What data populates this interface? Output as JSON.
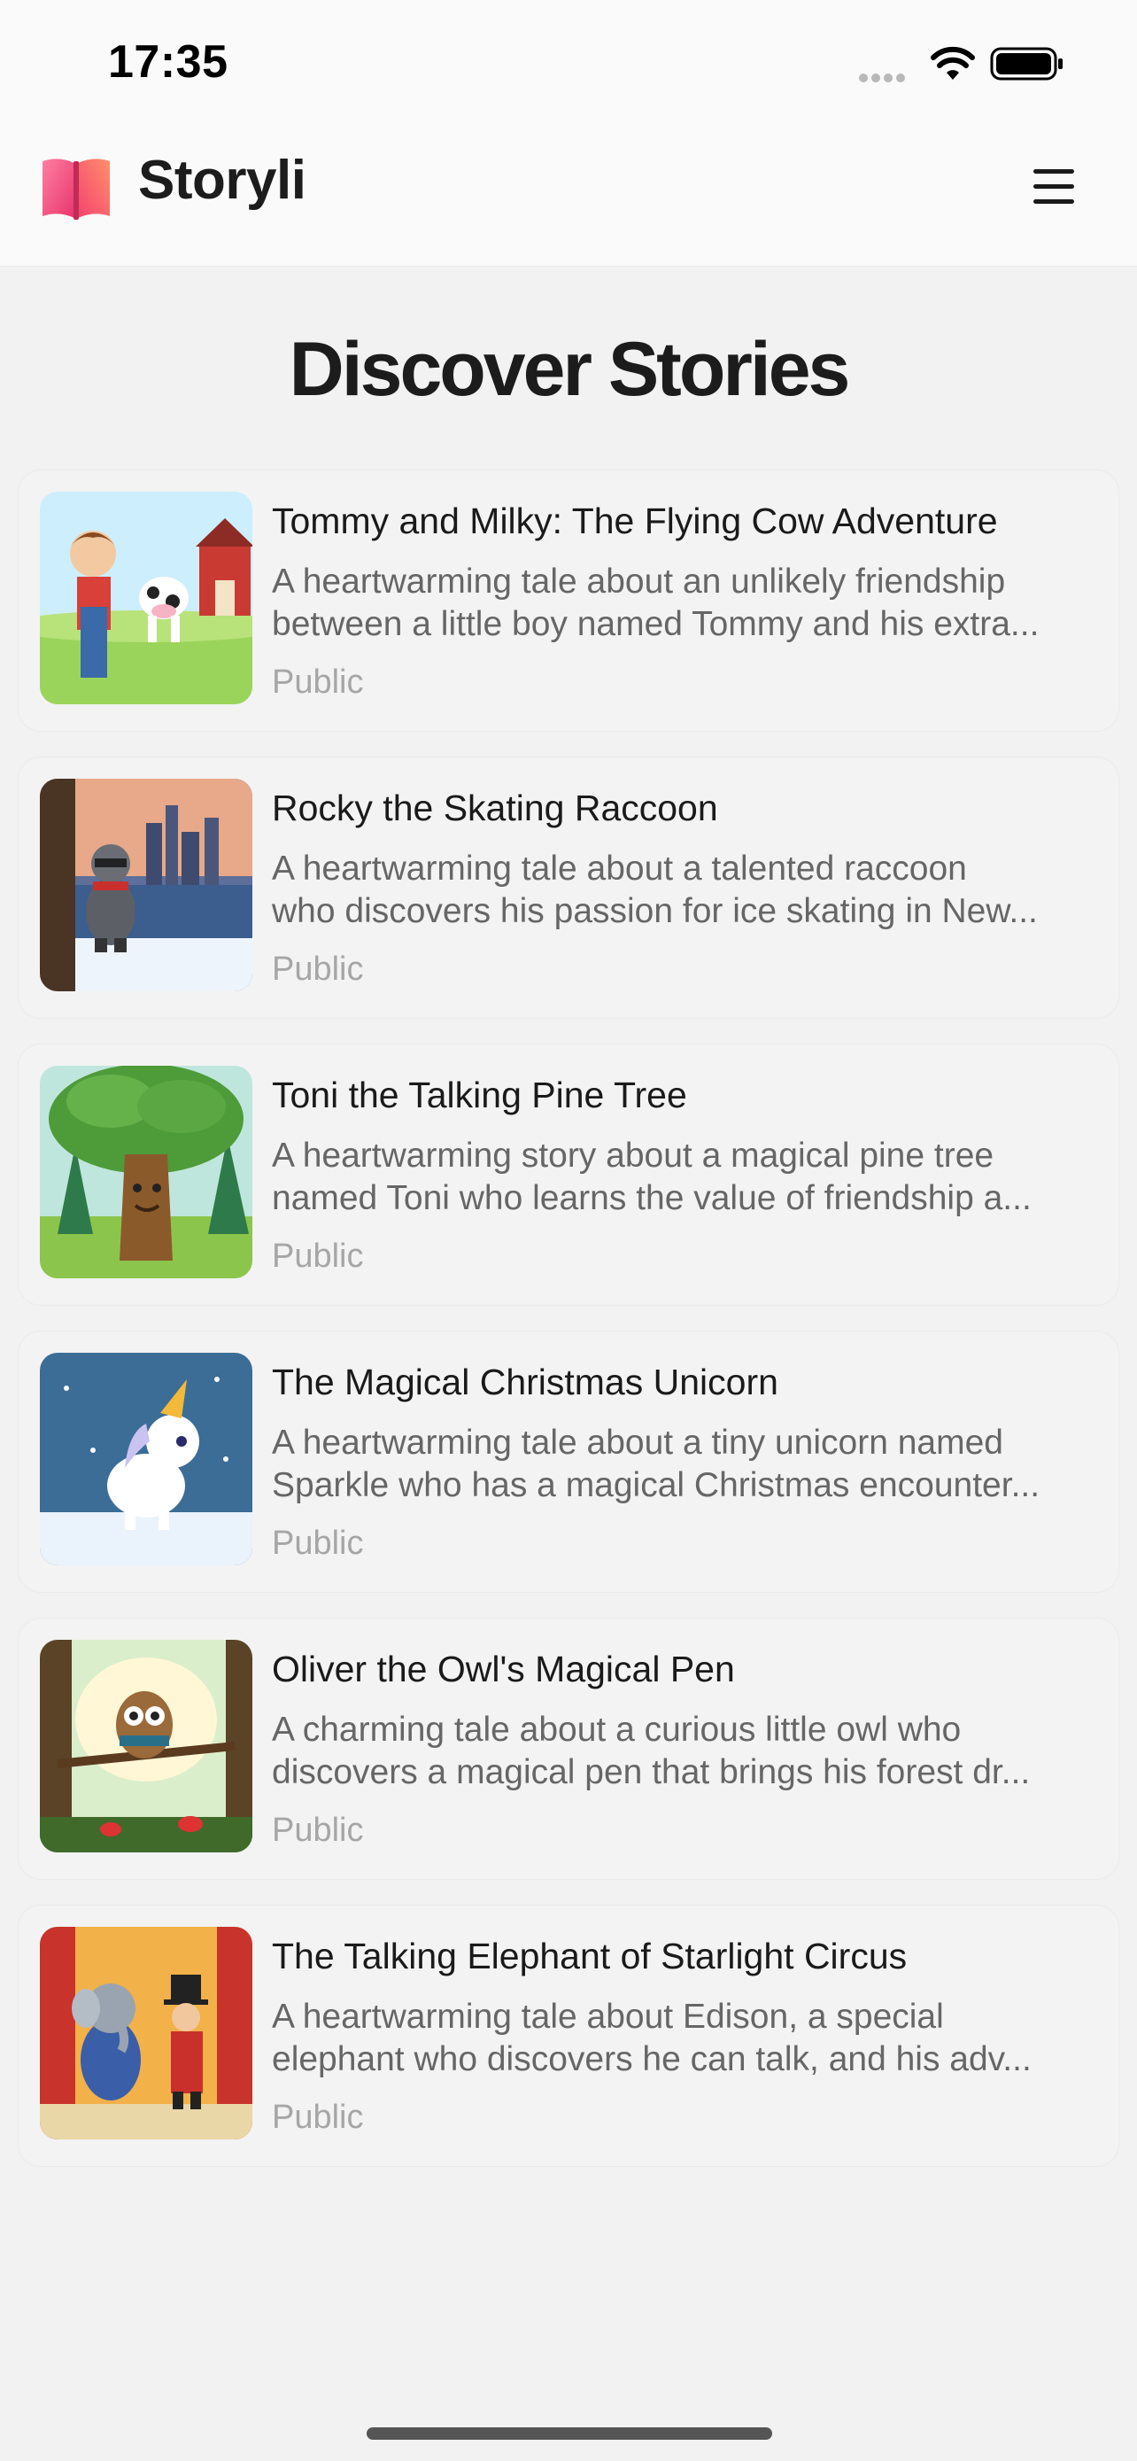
{
  "status_bar": {
    "time": "17:35"
  },
  "header": {
    "app_name": "Storyli",
    "logo_icon": "book-icon",
    "menu_icon": "hamburger-menu-icon"
  },
  "main": {
    "title": "Discover Stories",
    "stories": [
      {
        "title": "Tommy and Milky: The Flying Cow Adventure",
        "description_line1": "A heartwarming tale about an unlikely friendship",
        "description_line2": "between a little boy named Tommy and his extra...",
        "visibility": "Public"
      },
      {
        "title": "Rocky the Skating Raccoon",
        "description_line1": "A heartwarming tale about a talented raccoon",
        "description_line2": "who discovers his passion for ice skating in New...",
        "visibility": "Public"
      },
      {
        "title": "Toni the Talking Pine Tree",
        "description_line1": "A heartwarming story about a magical pine tree",
        "description_line2": "named Toni who learns the value of friendship a...",
        "visibility": "Public"
      },
      {
        "title": "The Magical Christmas Unicorn",
        "description_line1": "A heartwarming tale about a tiny unicorn named",
        "description_line2": "Sparkle who has a magical Christmas encounter...",
        "visibility": "Public"
      },
      {
        "title": "Oliver the Owl's Magical Pen",
        "description_line1": "A charming tale about a curious little owl who",
        "description_line2": "discovers a magical pen that brings his forest dr...",
        "visibility": "Public"
      },
      {
        "title": "The Talking Elephant of Starlight Circus",
        "description_line1": "A heartwarming tale about Edison, a special",
        "description_line2": "elephant who discovers he can talk, and his adv...",
        "visibility": "Public"
      }
    ]
  },
  "colors": {
    "background": "#f2f2f2",
    "header_background": "#fafafa",
    "text_primary": "#1a1a1a",
    "text_secondary": "#666666",
    "text_muted": "#a6a6a6",
    "logo_pink": "#ff5a8a"
  }
}
